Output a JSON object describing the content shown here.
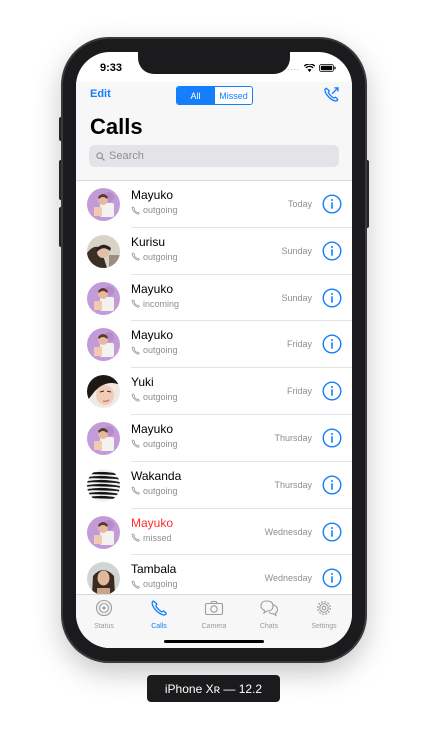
{
  "statusbar": {
    "time": "9:33",
    "signal_dots": "....",
    "wifi_icon": "wifi-icon",
    "battery_icon": "battery-icon"
  },
  "header": {
    "edit_label": "Edit",
    "segments": [
      {
        "label": "All",
        "active": true
      },
      {
        "label": "Missed",
        "active": false
      }
    ],
    "new_call_icon": "phone-plus-icon",
    "title": "Calls"
  },
  "search": {
    "placeholder": "Search"
  },
  "calls": [
    {
      "name": "Mayuko",
      "type": "outgoing",
      "day": "Today",
      "missed": false,
      "avatar": "mayuko"
    },
    {
      "name": "Kurisu",
      "type": "outgoing",
      "day": "Sunday",
      "missed": false,
      "avatar": "kurisu"
    },
    {
      "name": "Mayuko",
      "type": "incoming",
      "day": "Sunday",
      "missed": false,
      "avatar": "mayuko"
    },
    {
      "name": "Mayuko",
      "type": "outgoing",
      "day": "Friday",
      "missed": false,
      "avatar": "mayuko"
    },
    {
      "name": "Yuki",
      "type": "outgoing",
      "day": "Friday",
      "missed": false,
      "avatar": "yuki"
    },
    {
      "name": "Mayuko",
      "type": "outgoing",
      "day": "Thursday",
      "missed": false,
      "avatar": "mayuko"
    },
    {
      "name": "Wakanda",
      "type": "outgoing",
      "day": "Thursday",
      "missed": false,
      "avatar": "wakanda"
    },
    {
      "name": "Mayuko",
      "type": "missed",
      "day": "Wednesday",
      "missed": true,
      "avatar": "mayuko"
    },
    {
      "name": "Tambala",
      "type": "outgoing",
      "day": "Wednesday",
      "missed": false,
      "avatar": "tambala"
    }
  ],
  "tabs": [
    {
      "label": "Status",
      "icon": "status-icon",
      "active": false
    },
    {
      "label": "Calls",
      "icon": "phone-icon",
      "active": true
    },
    {
      "label": "Camera",
      "icon": "camera-icon",
      "active": false
    },
    {
      "label": "Chats",
      "icon": "chat-bubbles-icon",
      "active": false
    },
    {
      "label": "Settings",
      "icon": "gear-icon",
      "active": false
    }
  ],
  "colors": {
    "accent": "#147efb",
    "missed": "#ff2d2d",
    "secondary_text": "#8e8e93"
  },
  "device_label": "iPhone Xʀ — 12.2"
}
